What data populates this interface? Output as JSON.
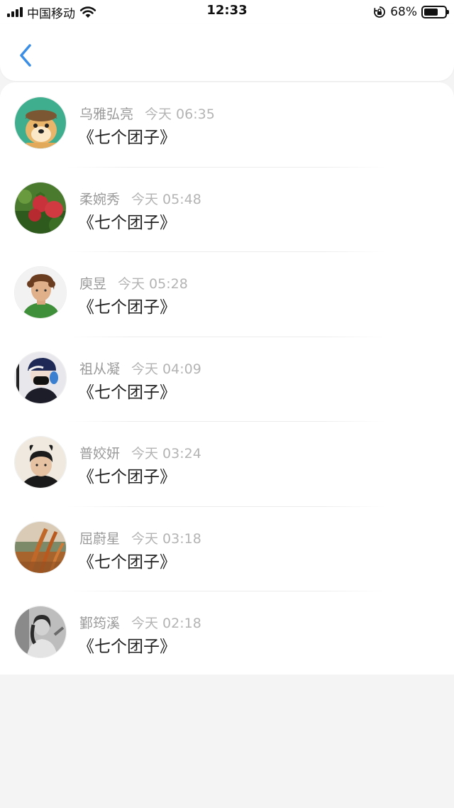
{
  "status_bar": {
    "carrier": "中国移动",
    "time": "12:33",
    "battery_percent": "68%",
    "battery_level": 0.68,
    "icons": [
      "signal-icon",
      "wifi-icon",
      "orientation-lock-icon",
      "battery-icon"
    ]
  },
  "nav": {
    "back_icon": "chevron-left-icon",
    "accent_color": "#3a8ee6"
  },
  "items": [
    {
      "name": "乌雅弘亮",
      "time": "今天 06:35",
      "title": "《七个团子》",
      "avatar": "cartoon-dog-helmet"
    },
    {
      "name": "柔婉秀",
      "time": "今天 05:48",
      "title": "《七个团子》",
      "avatar": "red-strawberries"
    },
    {
      "name": "庾昱",
      "time": "今天 05:28",
      "title": "《七个团子》",
      "avatar": "curly-hair-boy"
    },
    {
      "name": "祖从凝",
      "time": "今天 04:09",
      "title": "《七个团子》",
      "avatar": "masked-cap-person"
    },
    {
      "name": "普姣妍",
      "time": "今天 03:24",
      "title": "《七个团子》",
      "avatar": "boy-with-ears"
    },
    {
      "name": "屈蔚星",
      "time": "今天 03:18",
      "title": "《七个团子》",
      "avatar": "orange-landscape"
    },
    {
      "name": "鄞筠溪",
      "time": "今天 02:18",
      "title": "《七个团子》",
      "avatar": "grayscale-girl"
    }
  ]
}
